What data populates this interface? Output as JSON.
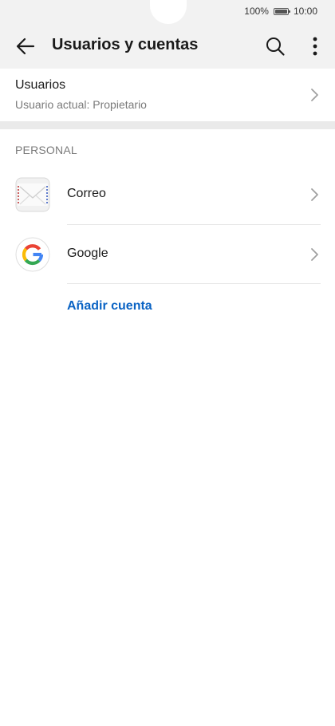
{
  "status_bar": {
    "battery_text": "100%",
    "time": "10:00",
    "battery_level": 1.0
  },
  "app_bar": {
    "title": "Usuarios y cuentas",
    "back_icon": "arrow-back-icon",
    "search_icon": "search-icon",
    "more_icon": "more-vert-icon"
  },
  "users": {
    "title": "Usuarios",
    "subtitle": "Usuario actual: Propietario"
  },
  "section": {
    "header": "PERSONAL"
  },
  "accounts": [
    {
      "label": "Correo",
      "icon": "mail-envelope-icon"
    },
    {
      "label": "Google",
      "icon": "google-g-icon"
    }
  ],
  "actions": {
    "add_account": "Añadir cuenta"
  },
  "colors": {
    "accent": "#0a63c4",
    "background": "#f2f2f2",
    "secondary_text": "#7a7a7a"
  }
}
